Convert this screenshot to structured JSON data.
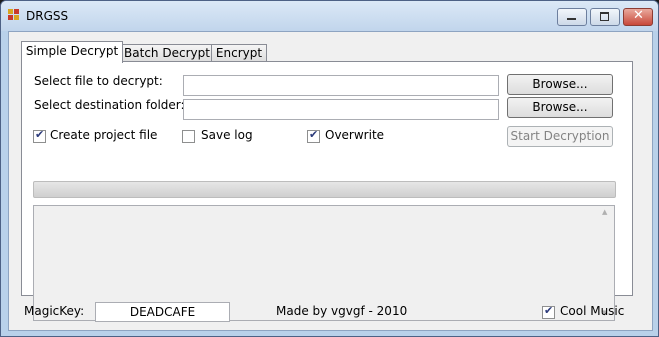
{
  "window": {
    "title": "DRGSS"
  },
  "tabs": [
    {
      "label": "Simple Decrypt"
    },
    {
      "label": "Batch Decrypt"
    },
    {
      "label": "Encrypt"
    }
  ],
  "simple_decrypt": {
    "source_label": "Select file to decrypt:",
    "source_value": "",
    "dest_label": "Select destination folder:",
    "dest_value": "",
    "browse_label": "Browse...",
    "create_project_label": "Create project file",
    "create_project_checked": true,
    "save_log_label": "Save log",
    "save_log_checked": false,
    "overwrite_label": "Overwrite",
    "overwrite_checked": true,
    "start_label": "Start Decryption",
    "progress": 0,
    "log_text": ""
  },
  "footer": {
    "magickey_label": "MagicKey:",
    "magickey_value": "DEADCAFE",
    "credit": "Made by vgvgf - 2010",
    "cool_music_label": "Cool Music",
    "cool_music_checked": true
  }
}
